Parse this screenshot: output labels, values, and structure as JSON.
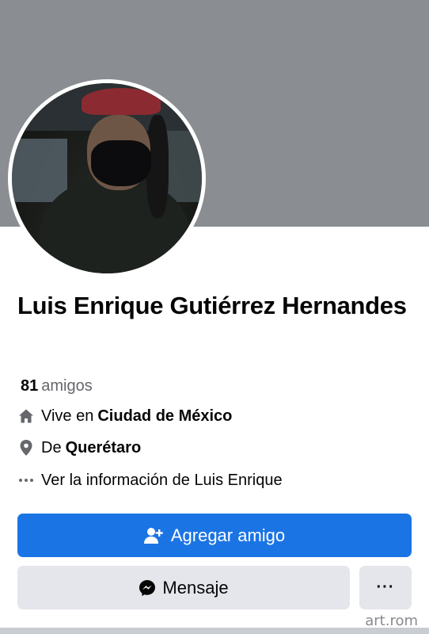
{
  "profile": {
    "name": "Luis Enrique Gutiérrez Hernandes",
    "friends_count": "81",
    "friends_label": "amigos",
    "lives_prefix": "Vive en",
    "lives_city": "Ciudad de México",
    "from_prefix": "De",
    "from_city": "Querétaro",
    "more_info": "Ver la información de Luis Enrique"
  },
  "actions": {
    "add_friend": "Agregar amigo",
    "message": "Mensaje",
    "more": "···"
  },
  "watermark": "art.rom",
  "colors": {
    "cover": "#8a8d91",
    "primary": "#1b74e4",
    "secondary_button": "#e4e6eb",
    "muted_text": "#65676b"
  },
  "icons": {
    "home": "home-icon",
    "location": "location-pin-icon",
    "more": "ellipsis-icon",
    "add_friend": "add-person-icon",
    "messenger": "messenger-icon"
  }
}
